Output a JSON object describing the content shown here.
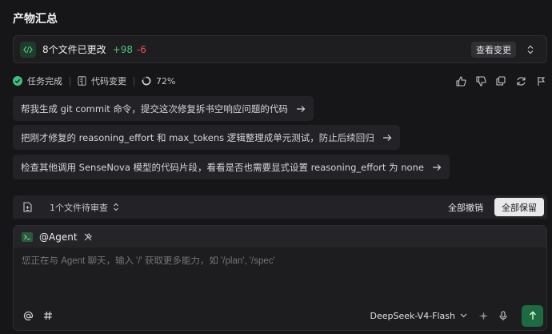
{
  "title": "产物汇总",
  "changes": {
    "summary": "8个文件已更改",
    "added": "+98",
    "removed": "-6",
    "view_button": "查看变更"
  },
  "status": {
    "task": "任务完成",
    "code_changes": "代码变更",
    "progress": "72%"
  },
  "suggestions": [
    "帮我生成 git commit 命令，提交这次修复拆书空响应问题的代码",
    "把刚才修复的 reasoning_effort 和 max_tokens 逻辑整理成单元测试，防止后续回归",
    "检查其他调用 SenseNova 模型的代码片段，看看是否也需要显式设置 reasoning_effort 为 none"
  ],
  "review": {
    "pending": "1个文件待审查",
    "revert_all": "全部撤销",
    "keep_all": "全部保留"
  },
  "composer": {
    "agent": "@Agent",
    "placeholder": "您正在与 Agent 聊天，输入 '/' 获取更多能力，如 '/plan', '/spec'",
    "model": "DeepSeek-V4-Flash"
  },
  "colors": {
    "added": "#4ec27a",
    "removed": "#e5534b",
    "success": "#3fbf7f",
    "send": "#1e6b41"
  }
}
